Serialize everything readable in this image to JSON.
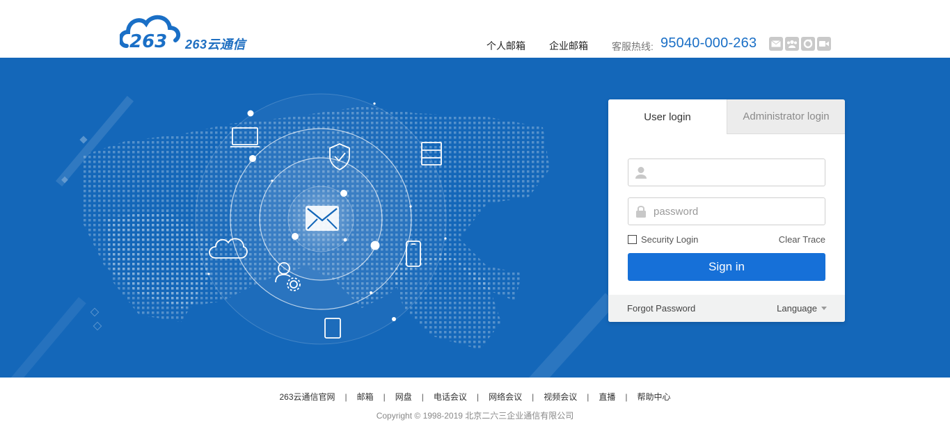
{
  "header": {
    "logo_text": "263云通信",
    "nav": [
      "个人邮箱",
      "企业邮箱"
    ],
    "hotline_label": "客服热线:",
    "hotline_number": "95040-000-263",
    "icons": [
      "mail-icon",
      "group-icon",
      "refresh-icon",
      "video-icon"
    ]
  },
  "login": {
    "tabs": [
      "User login",
      "Administrator login"
    ],
    "username_placeholder": "",
    "password_placeholder": "password",
    "security_login": "Security Login",
    "clear_trace": "Clear Trace",
    "signin": "Sign in",
    "forgot": "Forgot Password",
    "language": "Language"
  },
  "footer": {
    "links": [
      "263云通信官网",
      "邮箱",
      "网盘",
      "电话会议",
      "网络会议",
      "视频会议",
      "直播",
      "帮助中心"
    ],
    "copyright": "Copyright © 1998-2019 北京二六三企业通信有限公司"
  },
  "colors": {
    "banner": "#1467b9",
    "accent": "#1670d8",
    "hotline": "#1a6fc6"
  }
}
